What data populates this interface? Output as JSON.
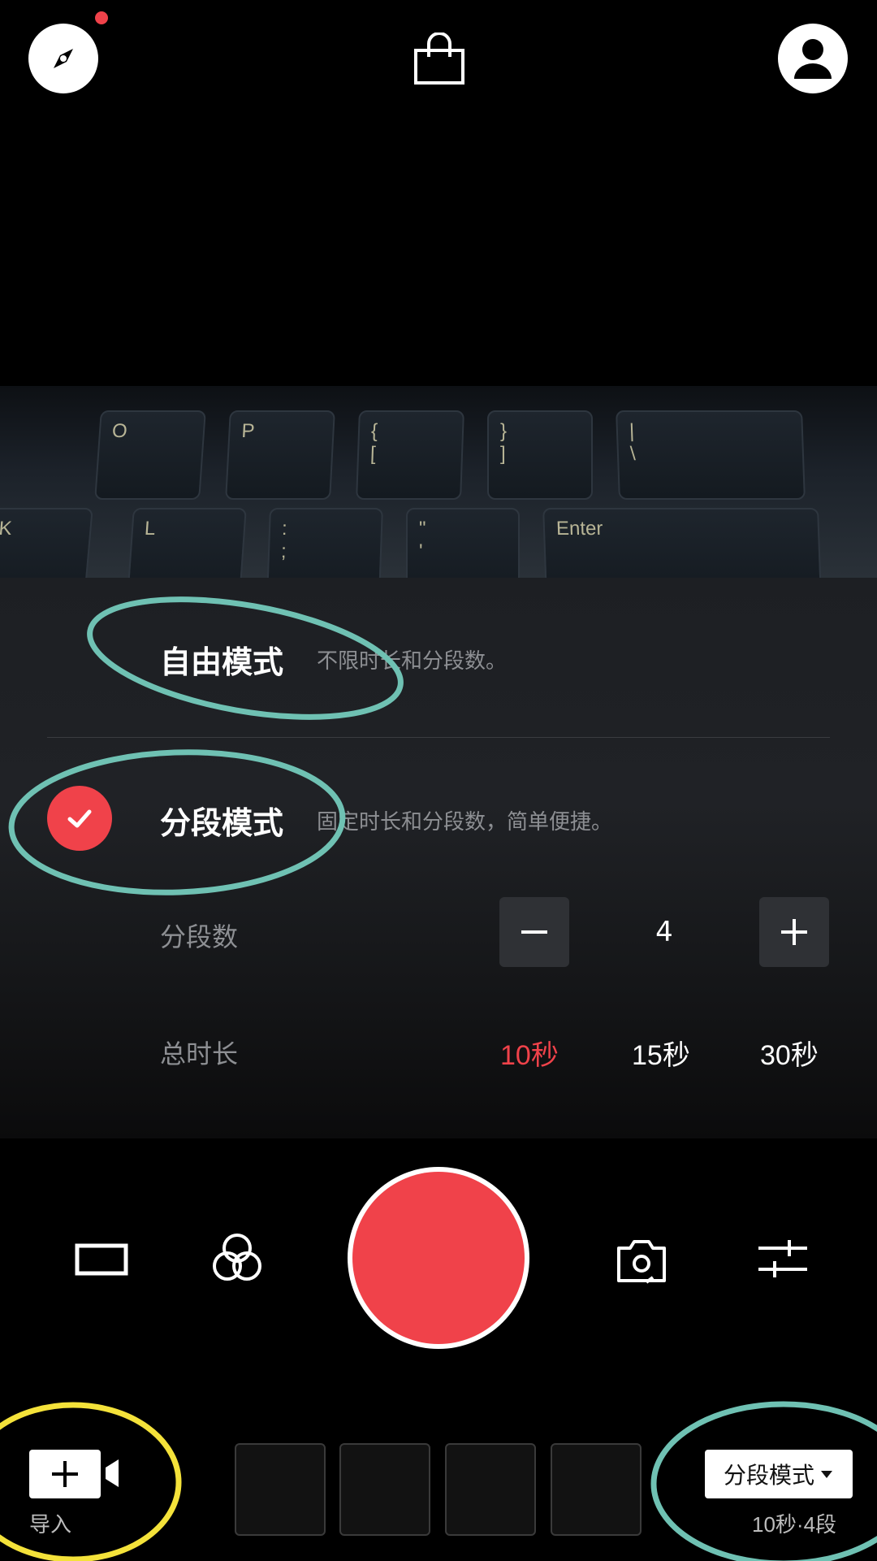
{
  "icons": {
    "explore": "compass-icon",
    "shop": "shopping-bag-icon",
    "profile": "profile-icon",
    "aspect": "aspect-ratio-icon",
    "filter": "filter-icon",
    "flip": "flip-camera-icon",
    "settings": "adjust-icon"
  },
  "preview": {
    "keys": [
      "O",
      "P",
      "{\n[",
      "}\n]",
      "|\n\\",
      "K",
      "L",
      ":\n;",
      "\"\n'",
      "Enter"
    ]
  },
  "modes": {
    "free": {
      "title": "自由模式",
      "desc": "不限时长和分段数。"
    },
    "segment": {
      "title": "分段模式",
      "desc": "固定时长和分段数，简单便捷。",
      "selected": true
    }
  },
  "segments": {
    "label": "分段数",
    "value": "4"
  },
  "duration": {
    "label": "总时长",
    "options": [
      "10秒",
      "15秒",
      "30秒"
    ],
    "selected": "10秒"
  },
  "bottom": {
    "import_label": "导入",
    "mode_chip": "分段模式",
    "mode_summary": "10秒·4段"
  },
  "colors": {
    "accent": "#f0424a",
    "annotation_teal": "#6fc1b3",
    "annotation_yellow": "#f4e23a"
  }
}
